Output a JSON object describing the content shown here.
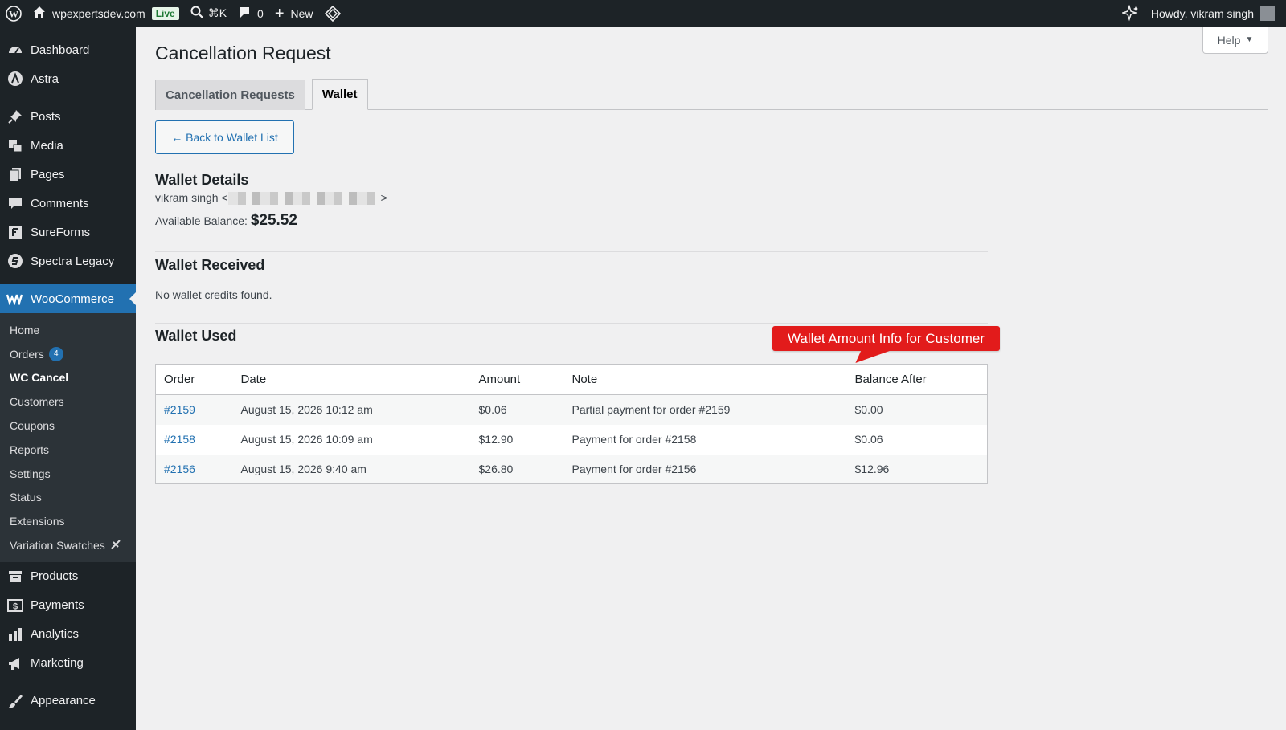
{
  "adminbar": {
    "site_name": "wpexpertsdev.com",
    "live_label": "Live",
    "search_shortcut": "⌘K",
    "comments_count": "0",
    "new_label": "New",
    "greeting": "Howdy, vikram singh"
  },
  "sidebar": {
    "items_top": [
      {
        "label": "Dashboard",
        "icon": "dashboard-icon"
      },
      {
        "label": "Astra",
        "icon": "astra-icon"
      }
    ],
    "items_content": [
      {
        "label": "Posts",
        "icon": "pin-icon"
      },
      {
        "label": "Media",
        "icon": "media-icon"
      },
      {
        "label": "Pages",
        "icon": "pages-icon"
      },
      {
        "label": "Comments",
        "icon": "comments-icon"
      },
      {
        "label": "SureForms",
        "icon": "sureforms-icon"
      },
      {
        "label": "Spectra Legacy",
        "icon": "spectra-icon"
      }
    ],
    "woocommerce": {
      "label": "WooCommerce",
      "icon": "woocommerce-icon"
    },
    "submenu": [
      {
        "label": "Home"
      },
      {
        "label": "Orders",
        "badge": "4"
      },
      {
        "label": "WC Cancel"
      },
      {
        "label": "Customers"
      },
      {
        "label": "Coupons"
      },
      {
        "label": "Reports"
      },
      {
        "label": "Settings"
      },
      {
        "label": "Status"
      },
      {
        "label": "Extensions"
      },
      {
        "label": "Variation Swatches"
      }
    ],
    "items_bottom": [
      {
        "label": "Products",
        "icon": "archive-icon"
      },
      {
        "label": "Payments",
        "icon": "payments-icon"
      },
      {
        "label": "Analytics",
        "icon": "analytics-icon"
      },
      {
        "label": "Marketing",
        "icon": "megaphone-icon"
      }
    ],
    "items_appearance": [
      {
        "label": "Appearance",
        "icon": "brush-icon"
      }
    ]
  },
  "main": {
    "help_label": "Help",
    "page_title": "Cancellation Request",
    "tabs": [
      {
        "label": "Cancellation Requests"
      },
      {
        "label": "Wallet"
      }
    ],
    "back_button": "← Back to Wallet List",
    "wallet_details": {
      "heading": "Wallet Details",
      "customer_name": "vikram singh <",
      "email_suffix": ">",
      "balance_label": "Available Balance:",
      "balance_value": "$25.52"
    },
    "wallet_received": {
      "heading": "Wallet Received",
      "empty_text": "No wallet credits found."
    },
    "wallet_used": {
      "heading": "Wallet Used",
      "columns": [
        "Order",
        "Date",
        "Amount",
        "Note",
        "Balance After"
      ],
      "rows": [
        {
          "order": "#2159",
          "date": "August 15, 2026 10:12 am",
          "amount": "$0.06",
          "note": "Partial payment for order #2159",
          "balance_after": "$0.00"
        },
        {
          "order": "#2158",
          "date": "August 15, 2026 10:09 am",
          "amount": "$12.90",
          "note": "Payment for order #2158",
          "balance_after": "$0.06"
        },
        {
          "order": "#2156",
          "date": "August 15, 2026 9:40 am",
          "amount": "$26.80",
          "note": "Payment for order #2156",
          "balance_after": "$12.96"
        }
      ]
    },
    "callout": "Wallet Amount Info for Customer"
  },
  "colors": {
    "admin_dark": "#1d2327",
    "accent_blue": "#2271b1",
    "callout_red": "#e21b1b"
  }
}
